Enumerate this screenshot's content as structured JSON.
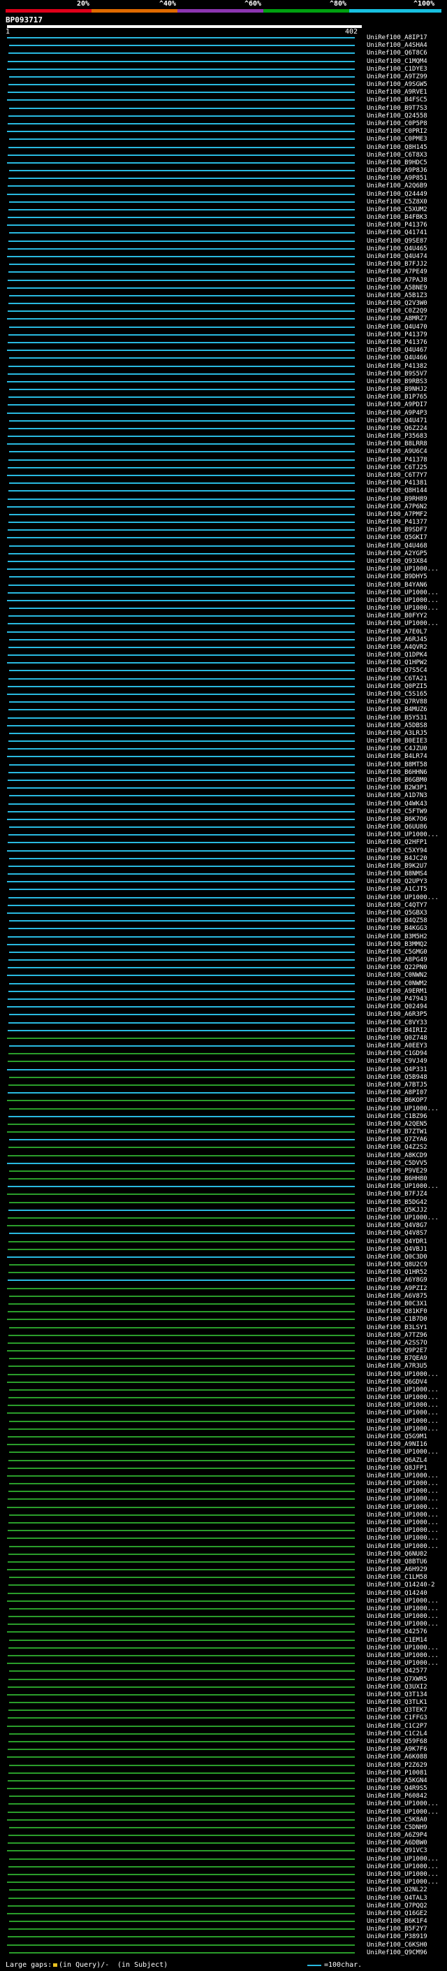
{
  "header": {
    "percent_labels": [
      "20%",
      "^40%",
      "^60%",
      "^80%",
      "^100%"
    ],
    "bar_colors": [
      "#e0001a",
      "#e06a00",
      "#8c35b0",
      "#00a010",
      "#18c0e0"
    ],
    "query_id": "BP093717",
    "query_start": "1",
    "query_end": "402"
  },
  "legend": {
    "large_gaps_label": "Large gaps:",
    "in_query_label": "(in Query)/-",
    "in_subject_label": "(in Subject)",
    "scale_label": "=100char."
  },
  "colors": {
    "cyan": "#29b9e0",
    "green": "#2a9d2a",
    "magenta": "#cc2e9a",
    "query": "#ffffff"
  },
  "hits": [
    "UniRef100_A8IP17",
    "UniRef100_A4SHA4",
    "UniRef100_Q6T8C6",
    "UniRef100_C1MQM4",
    "UniRef100_C1DYE3",
    "UniRef100_A9TZ99",
    "UniRef100_A9SGW5",
    "UniRef100_A9RVE1",
    "UniRef100_B4FSC5",
    "UniRef100_B9T7S3",
    "UniRef100_Q24558",
    "UniRef100_C0P5P8",
    "UniRef100_C0PRI2",
    "UniRef100_C0PME3",
    "UniRef100_Q8H145",
    "UniRef100_C6T8X3",
    "UniRef100_B9HDC5",
    "UniRef100_A9P8J6",
    "UniRef100_A9P851",
    "UniRef100_A2Q6B9",
    "UniRef100_Q24449",
    "UniRef100_C5Z8X0",
    "UniRef100_C5XUM2",
    "UniRef100_B4FBK3",
    "UniRef100_P41376",
    "UniRef100_Q41741",
    "UniRef100_Q9SE87",
    "UniRef100_Q4U465",
    "UniRef100_Q4U474",
    "UniRef100_B7FJJ2",
    "UniRef100_A7PE49",
    "UniRef100_A7PAJ8",
    "UniRef100_A5BNE9",
    "UniRef100_A5B1Z3",
    "UniRef100_Q2V3W0",
    "UniRef100_C0Z2Q9",
    "UniRef100_A8MRZ7",
    "UniRef100_Q4U470",
    "UniRef100_P41379",
    "UniRef100_P41376",
    "UniRef100_Q4U467",
    "UniRef100_Q4U466",
    "UniRef100_P41382",
    "UniRef100_B9S5V7",
    "UniRef100_B9RBS3",
    "UniRef100_B9NHJ2",
    "UniRef100_B1P765",
    "UniRef100_A9PDI7",
    "UniRef100_A9P4P3",
    "UniRef100_Q4U471",
    "UniRef100_Q6Z224",
    "UniRef100_P35683",
    "UniRef100_B8LRR8",
    "UniRef100_A9U6C4",
    "UniRef100_P41378",
    "UniRef100_C6TJ25",
    "UniRef100_C6T7Y7",
    "UniRef100_P41381",
    "UniRef100_Q8H144",
    "UniRef100_B9RH89",
    "UniRef100_A7P6N2",
    "UniRef100_A7PMF2",
    "UniRef100_P41377",
    "UniRef100_B9SDF7",
    "UniRef100_Q5GKI7",
    "UniRef100_Q4U468",
    "UniRef100_A2YGP5",
    "UniRef100_Q93X84",
    "UniRef100_UP1000...",
    "UniRef100_B9DHY5",
    "UniRef100_B4YAN6",
    "UniRef100_UP1000...",
    "UniRef100_UP1000...",
    "UniRef100_UP1000...",
    "UniRef100_B0FYY2",
    "UniRef100_UP1000...",
    "UniRef100_A7E0L7",
    "UniRef100_A6RJ45",
    "UniRef100_A4QVR2",
    "UniRef100_Q1DPK4",
    "UniRef100_Q1HPW2",
    "UniRef100_Q7S5C4",
    "UniRef100_C6TA21",
    "UniRef100_Q0PZI5",
    "UniRef100_C5S165",
    "UniRef100_Q7RV88",
    "UniRef100_B4MUZ6",
    "UniRef100_B5Y531",
    "UniRef100_A5DBS8",
    "UniRef100_A3LRJ5",
    "UniRef100_B0EIE3",
    "UniRef100_C4JZU0",
    "UniRef100_B4LR74",
    "UniRef100_B8MT58",
    "UniRef100_B6HHN6",
    "UniRef100_B6GBM0",
    "UniRef100_B2W3P1",
    "UniRef100_A1D7N3",
    "UniRef100_Q4WK43",
    "UniRef100_C5FTW9",
    "UniRef100_B6K7O6",
    "UniRef100_Q6UU86",
    "UniRef100_UP1000...",
    "UniRef100_Q2HFP1",
    "UniRef100_C5XY94",
    "UniRef100_B4JC20",
    "UniRef100_B9K2U7",
    "UniRef100_B8NMS4",
    "UniRef100_Q2UPY3",
    "UniRef100_A1CJT5",
    "UniRef100_UP1000...",
    "UniRef100_C4QTY7",
    "UniRef100_Q5GBX3",
    "UniRef100_B4QZ58",
    "UniRef100_B4KGG3",
    "UniRef100_B3M5H2",
    "UniRef100_B3MMQ2",
    "UniRef100_C5GMG0",
    "UniRef100_A8PG49",
    "UniRef100_Q22PN0",
    "UniRef100_C0NWN2",
    "UniRef100_C0NWM2",
    "UniRef100_A9ERM1",
    "UniRef100_P47943",
    "UniRef100_Q02494",
    "UniRef100_A6R3P5",
    "UniRef100_C8VY33",
    "UniRef100_B4IRI2",
    "UniRef100_Q0Z748",
    "UniRef100_A0EEY3",
    "UniRef100_C1GD94",
    "UniRef100_C9VJ49",
    "UniRef100_Q4P331",
    "UniRef100_Q5B948",
    "UniRef100_A7BTJ5",
    "UniRef100_A8PI07",
    "UniRef100_B6KOP7",
    "UniRef100_UP1000...",
    "UniRef100_C1BZ96",
    "UniRef100_A2QEN5",
    "UniRef100_B7ZTW1",
    "UniRef100_Q7ZYA6",
    "UniRef100_Q4Z2S2",
    "UniRef100_A8KCD9",
    "UniRef100_C5DVV5",
    "UniRef100_P9VE29",
    "UniRef100_B6HH80",
    "UniRef100_UP1000...",
    "UniRef100_B7FJZ4",
    "UniRef100_B5DG42",
    "UniRef100_Q5KJJ2",
    "UniRef100_UP1000...",
    "UniRef100_Q4V8G7",
    "UniRef100_Q4V8S7",
    "UniRef100_Q4YDR1",
    "UniRef100_Q4VBJ1",
    "UniRef100_Q0C3D0",
    "UniRef100_Q8U2C9",
    "UniRef100_Q1HR52",
    "UniRef100_A6Y8G9",
    "UniRef100_A9PZI2",
    "UniRef100_A6V875",
    "UniRef100_B0C3X1",
    "UniRef100_Q81KF0",
    "UniRef100_C1B7D0",
    "UniRef100_B3LSY1",
    "UniRef100_A7TZ96",
    "UniRef100_A2SS7O",
    "UniRef100_Q9P2E7",
    "UniRef100_B7QEA9",
    "UniRef100_A7R3U5",
    "UniRef100_UP1000...",
    "UniRef100_Q6GDV4",
    "UniRef100_UP1000...",
    "UniRef100_UP1000...",
    "UniRef100_UP1000...",
    "UniRef100_UP1000...",
    "UniRef100_UP1000...",
    "UniRef100_UP1000...",
    "UniRef100_Q5G9M1",
    "UniRef100_A9NI16",
    "UniRef100_UP1000...",
    "UniRef100_Q6AZL4",
    "UniRef100_Q8JFP1",
    "UniRef100_UP1000...",
    "UniRef100_UP1000...",
    "UniRef100_UP1000...",
    "UniRef100_UP1000...",
    "UniRef100_UP1000...",
    "UniRef100_UP1000...",
    "UniRef100_UP1000...",
    "UniRef100_UP1000...",
    "UniRef100_UP1000...",
    "UniRef100_UP1000...",
    "UniRef100_Q6NU02",
    "UniRef100_Q8BTU6",
    "UniRef100_A6H929",
    "UniRef100_C1LM58",
    "UniRef100_Q14240-2",
    "UniRef100_Q14240",
    "UniRef100_UP1000...",
    "UniRef100_UP1000...",
    "UniRef100_UP1000...",
    "UniRef100_UP1000...",
    "UniRef100_Q42576",
    "UniRef100_C1EM14",
    "UniRef100_UP1000...",
    "UniRef100_UP1000...",
    "UniRef100_UP1000...",
    "UniRef100_Q42577",
    "UniRef100_Q7XWR5",
    "UniRef100_Q3UXI2",
    "UniRef100_Q3T134",
    "UniRef100_Q3TLK1",
    "UniRef100_Q3TEK7",
    "UniRef100_C1FFG3",
    "UniRef100_C1C2P7",
    "UniRef100_C1C2L4",
    "UniRef100_Q59F68",
    "UniRef100_A9K7F6",
    "UniRef100_A6K088",
    "UniRef100_P2Z629",
    "UniRef100_P10081",
    "UniRef100_A5KGN4",
    "UniRef100_Q4R9S5",
    "UniRef100_P60842",
    "UniRef100_UP1000...",
    "UniRef100_UP1000...",
    "UniRef100_C5K8A0",
    "UniRef100_C5DNH9",
    "UniRef100_A6Z9P4",
    "UniRef100_A6DBW0",
    "UniRef100_Q91VC3",
    "UniRef100_UP1000...",
    "UniRef100_UP1000...",
    "UniRef100_UP1000...",
    "UniRef100_UP1000...",
    "UniRef100_Q2NL22",
    "UniRef100_Q4TAL3",
    "UniRef100_Q7PQQ2",
    "UniRef100_Q16GE2",
    "UniRef100_B6K1F4",
    "UniRef100_B5F2Y7",
    "UniRef100_P38919",
    "UniRef100_C6KSH0",
    "UniRef100_Q9CM96"
  ]
}
